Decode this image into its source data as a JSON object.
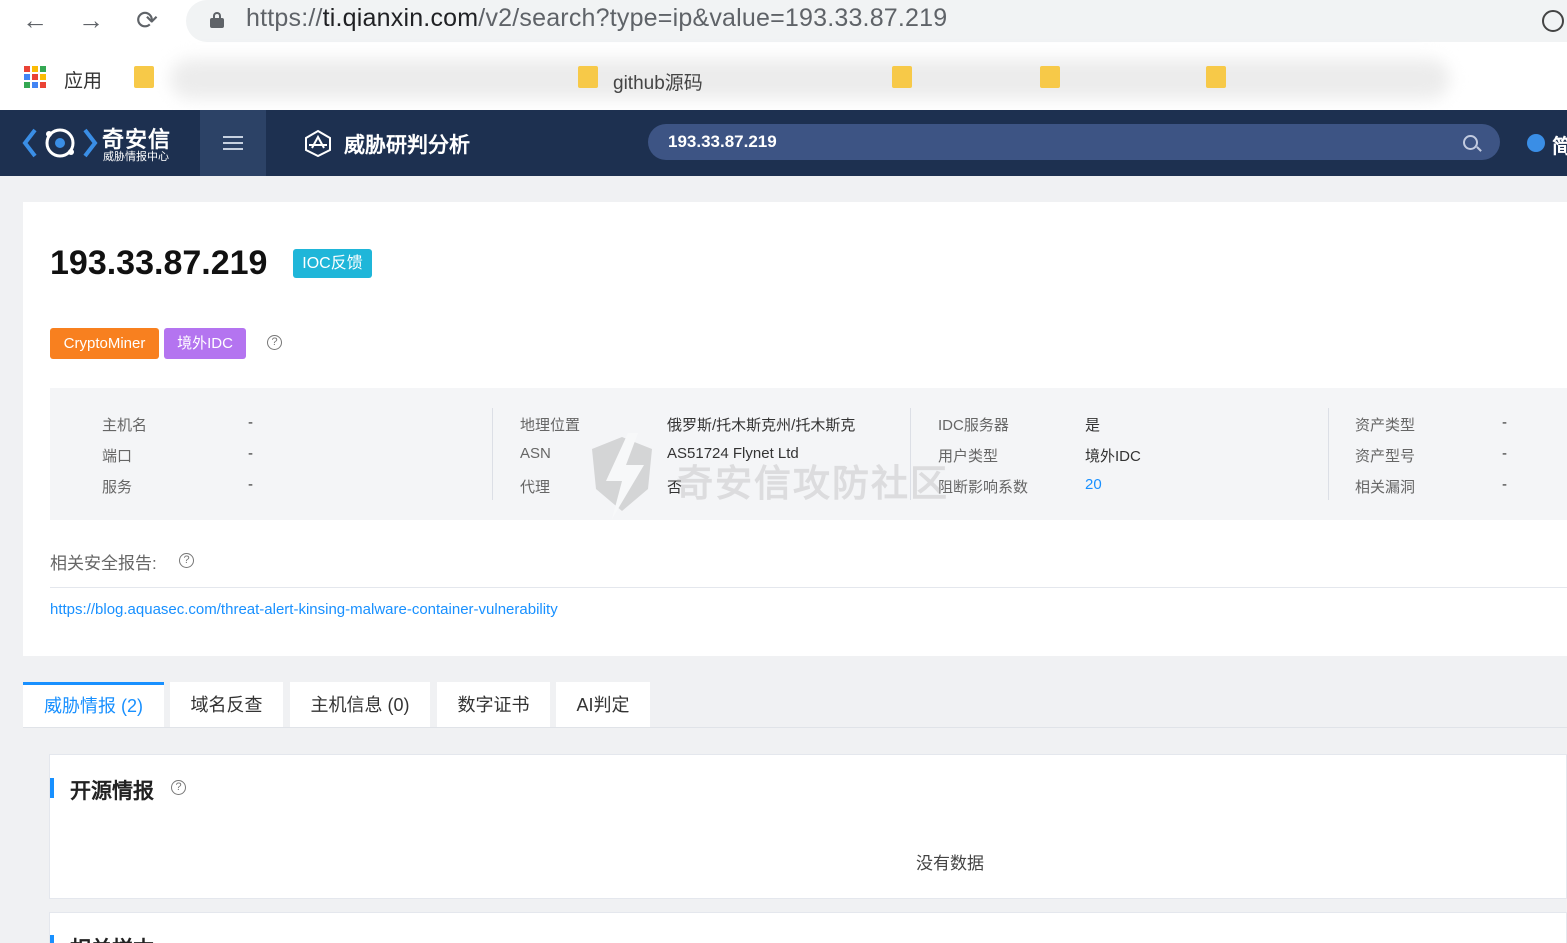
{
  "browser": {
    "url_scheme": "https://",
    "url_host": "ti.qianxin.com",
    "url_path": "/v2/search?type=ip&value=193.33.87.219",
    "bookmarks_apps_label": "应用",
    "bookmark_visible_text": "github源码"
  },
  "header": {
    "logo_title": "奇安信",
    "logo_subtitle": "威胁情报中心",
    "brand_title": "威胁研判分析",
    "search_value": "193.33.87.219",
    "lang_label": "简"
  },
  "summary": {
    "ip": "193.33.87.219",
    "ioc_badge": "IOC反馈",
    "tags": [
      "CryptoMiner",
      "境外IDC"
    ],
    "info_columns": [
      [
        {
          "label": "主机名",
          "value": "-"
        },
        {
          "label": "端口",
          "value": "-"
        },
        {
          "label": "服务",
          "value": "-"
        }
      ],
      [
        {
          "label": "地理位置",
          "value": "俄罗斯/托木斯克州/托木斯克"
        },
        {
          "label": "ASN",
          "value": "AS51724 Flynet Ltd"
        },
        {
          "label": "代理",
          "value": "否"
        }
      ],
      [
        {
          "label": "IDC服务器",
          "value": "是"
        },
        {
          "label": "用户类型",
          "value": "境外IDC"
        },
        {
          "label": "阻断影响系数",
          "value": "20"
        }
      ],
      [
        {
          "label": "资产类型",
          "value": "-"
        },
        {
          "label": "资产型号",
          "value": "-"
        },
        {
          "label": "相关漏洞",
          "value": "-"
        }
      ]
    ],
    "report_label": "相关安全报告:",
    "report_link": "https://blog.aquasec.com/threat-alert-kinsing-malware-container-vulnerability"
  },
  "watermark_text": "奇安信攻防社区",
  "tabs": [
    "威胁情报 (2)",
    "域名反查",
    "主机信息 (0)",
    "数字证书",
    "AI判定"
  ],
  "sections": {
    "open_source_title": "开源情报",
    "open_source_empty": "没有数据",
    "related_samples_title": "相关样本"
  },
  "colors": {
    "header_bg": "#1d3050",
    "accent": "#1890ff",
    "tag_orange": "#f8801f",
    "tag_purple": "#b474f0",
    "ioc_badge": "#1fb6d9"
  }
}
